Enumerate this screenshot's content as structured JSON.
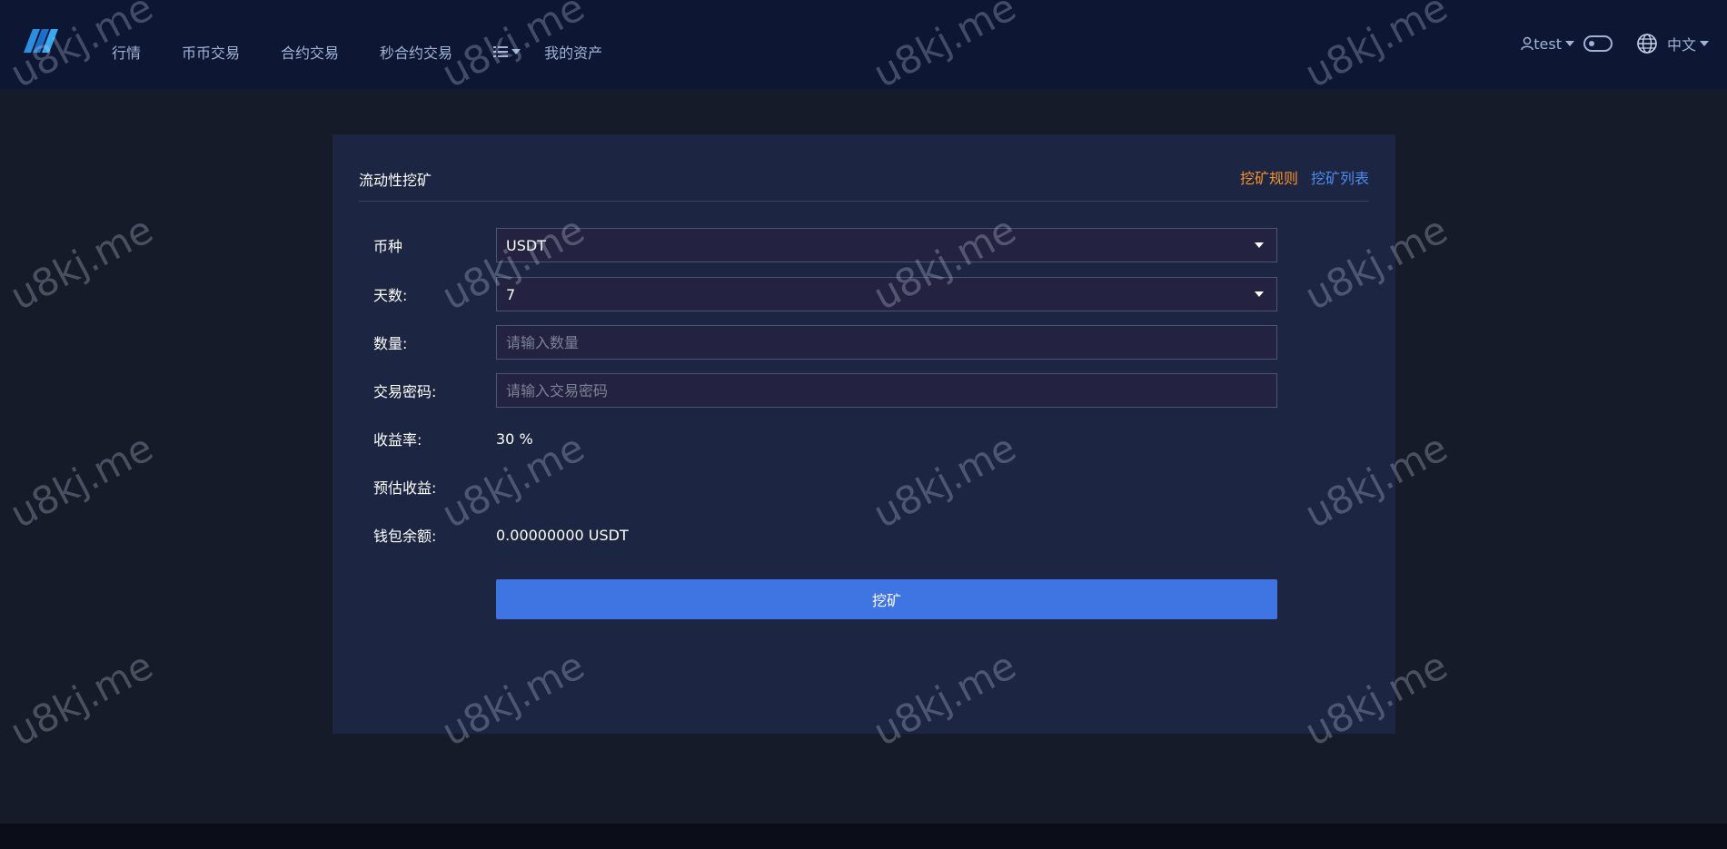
{
  "header": {
    "logo_text": "",
    "nav": [
      "行情",
      "币币交易",
      "合约交易",
      "秒合约交易"
    ],
    "more_icon": "list-icon",
    "assets_label": "我的资产",
    "user_label": "test",
    "language_label": "中文"
  },
  "mining": {
    "title": "流动性挖矿",
    "rules_link": "挖矿规则",
    "list_link": "挖矿列表",
    "currency_label": "币种",
    "currency_value": "USDT",
    "days_label": "天数:",
    "days_value": "7",
    "amount_label": "数量:",
    "amount_placeholder": "请输入数量",
    "password_label": "交易密码:",
    "password_placeholder": "请输入交易密码",
    "yield_label": "收益率:",
    "yield_value": "30 %",
    "estimate_label": "预估收益:",
    "estimate_value": "",
    "balance_label": "钱包余额:",
    "balance_value": "0.00000000 USDT",
    "submit_label": "挖矿"
  },
  "watermark": "u8kj.me",
  "colors": {
    "accent": "#3f74e3",
    "rules_link": "#f7922e",
    "list_link": "#4d8cf0",
    "header_bg": "#0d1633",
    "card_bg": "#1c2541"
  }
}
